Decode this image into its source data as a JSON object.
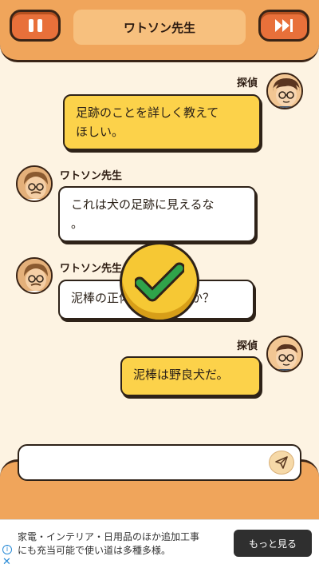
{
  "header": {
    "title": "ワトソン先生",
    "pause_icon": "pause-icon",
    "skip_icon": "fast-forward-icon"
  },
  "messages": [
    {
      "speaker": "探偵",
      "side": "right",
      "text": "足跡のことを詳しく教えて\nほしい。"
    },
    {
      "speaker": "ワトソン先生",
      "side": "left",
      "text": "これは犬の足跡に見えるな\n。"
    },
    {
      "speaker": "ワトソン先生",
      "side": "left",
      "text": "泥棒の正体は何だったか？"
    },
    {
      "speaker": "探偵",
      "side": "right",
      "text": "泥棒は野良犬だ。"
    }
  ],
  "result_icon": "checkmark-icon",
  "input": {
    "value": "",
    "send_icon": "send-icon"
  },
  "ad": {
    "text": "家電・インテリア・日用品のほか追加工事\nにも充当可能で使い道は多種多様。",
    "button": "もっと見る",
    "info_icon": "info-icon",
    "close_icon": "close-icon"
  },
  "colors": {
    "background": "#fdf3e2",
    "header": "#f0a55b",
    "button": "#e8703a",
    "player_bubble": "#fcd24a",
    "npc_bubble": "#ffffff",
    "check": "#f6c834",
    "check_mark": "#2fa34a"
  }
}
